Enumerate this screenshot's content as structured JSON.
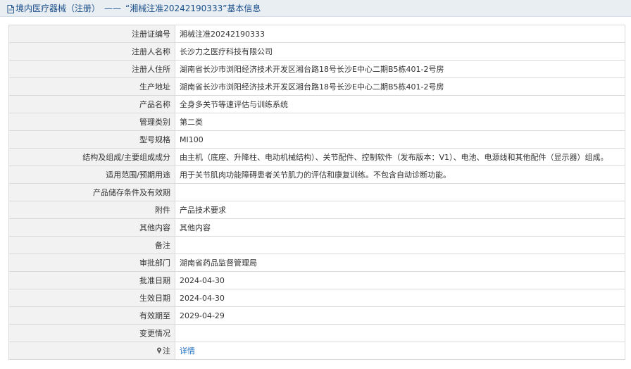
{
  "header": {
    "title_prefix": "境内医疗器械（注册）",
    "dash": "——",
    "title_suffix": "“湘械注准20242190333”基本信息"
  },
  "rows": [
    {
      "label": "注册证编号",
      "value": "湘械注准20242190333"
    },
    {
      "label": "注册人名称",
      "value": "长沙力之医疗科技有限公司"
    },
    {
      "label": "注册人住所",
      "value": "湖南省长沙市浏阳经济技术开发区湘台路18号长沙E中心二期B5栋401-2号房"
    },
    {
      "label": "生产地址",
      "value": "湖南省长沙市浏阳经济技术开发区湘台路18号长沙E中心二期B5栋401-2号房"
    },
    {
      "label": "产品名称",
      "value": "全身多关节等速评估与训练系统"
    },
    {
      "label": "管理类别",
      "value": "第二类"
    },
    {
      "label": "型号规格",
      "value": "MI100"
    },
    {
      "label": "结构及组成/主要组成成分",
      "value": "由主机（底座、升降柱、电动机械结构）、关节配件、控制软件（发布版本：V1）、电池、电源线和其他配件（显示器）组成。"
    },
    {
      "label": "适用范围/预期用途",
      "value": "用于关节肌肉功能障碍患者关节肌力的评估和康复训练。不包含自动诊断功能。"
    },
    {
      "label": "产品储存条件及有效期",
      "value": ""
    },
    {
      "label": "附件",
      "value": "产品技术要求"
    },
    {
      "label": "其他内容",
      "value": "其他内容"
    },
    {
      "label": "备注",
      "value": ""
    },
    {
      "label": "审批部门",
      "value": "湖南省药品监督管理局"
    },
    {
      "label": "批准日期",
      "value": "2024-04-30"
    },
    {
      "label": "生效日期",
      "value": "2024-04-30"
    },
    {
      "label": "有效期至",
      "value": "2029-04-29"
    },
    {
      "label": "变更情况",
      "value": ""
    }
  ],
  "note_row": {
    "label": "注",
    "link_text": "详情",
    "icon": "pin-icon"
  },
  "colors": {
    "header_bg": "#e9eef3",
    "label_bg": "#f2f2f2",
    "link": "#1f6fbf",
    "title": "#1a4f8a"
  }
}
